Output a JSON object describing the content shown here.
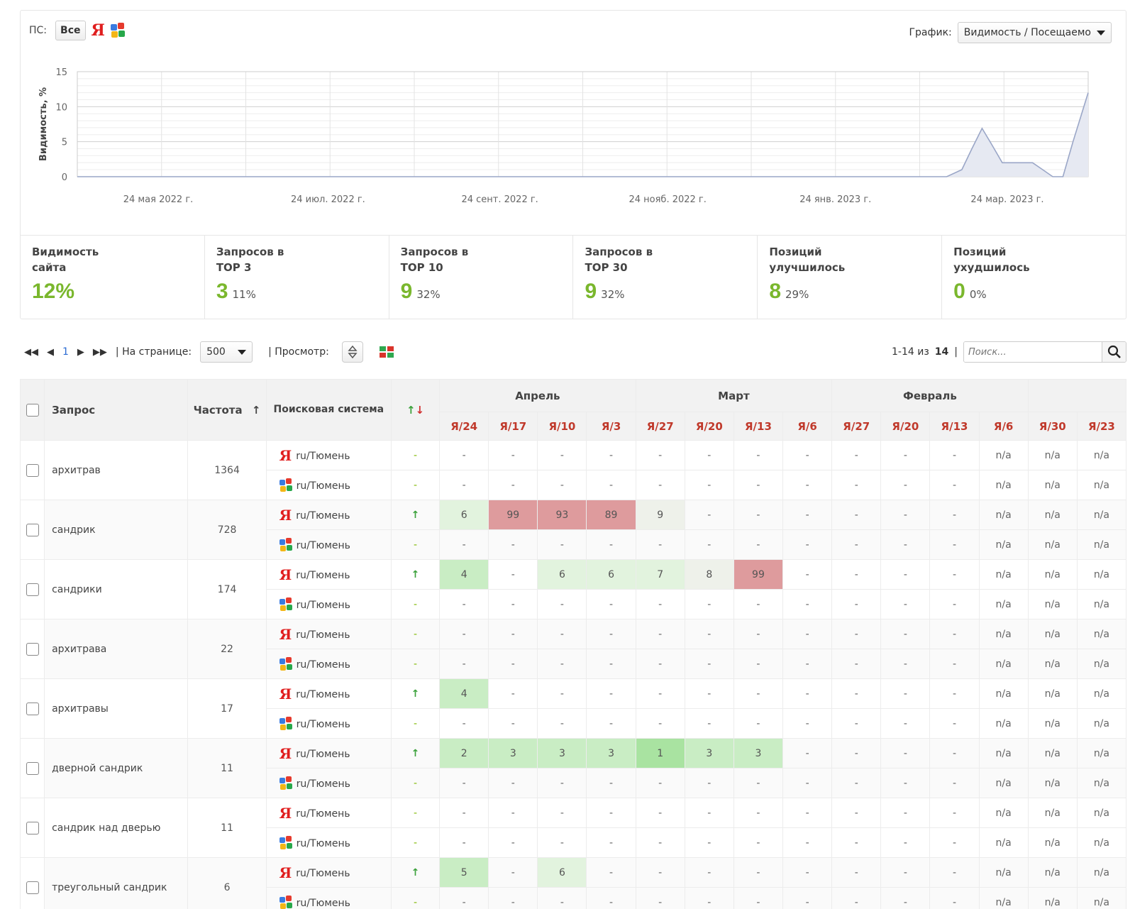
{
  "filter": {
    "ps_label": "ПС:",
    "all_label": "Все",
    "yandex_icon": "yandex-icon",
    "google_icon": "google-icon"
  },
  "graph": {
    "label": "График:",
    "selected": "Видимость / Посещаемо"
  },
  "chart_data": {
    "type": "area",
    "ylabel": "Видимость, %",
    "ylim": [
      0,
      15
    ],
    "yticks": [
      0,
      5,
      10,
      15
    ],
    "x_ticks": [
      "24 мая 2022 г.",
      "24 июл. 2022 г.",
      "24 сент. 2022 г.",
      "24 нояб. 2022 г.",
      "24 янв. 2023 г.",
      "24 мар. 2023 г."
    ],
    "grid": true,
    "series": [
      {
        "points": [
          [
            0,
            0
          ],
          [
            0.86,
            0
          ],
          [
            0.875,
            1
          ],
          [
            0.885,
            4
          ],
          [
            0.895,
            6.9
          ],
          [
            0.905,
            4.5
          ],
          [
            0.915,
            2
          ],
          [
            0.93,
            2
          ],
          [
            0.945,
            2
          ],
          [
            0.955,
            1
          ],
          [
            0.965,
            0
          ],
          [
            0.975,
            0
          ],
          [
            0.985,
            5
          ],
          [
            1.0,
            12
          ]
        ]
      }
    ],
    "color": "#9aa6c7"
  },
  "stats": [
    {
      "title": "Видимость\nсайта",
      "value": "12%",
      "pct": ""
    },
    {
      "title": "Запросов в\nTOP 3",
      "value": "3",
      "pct": "11%"
    },
    {
      "title": "Запросов в\nTOP 10",
      "value": "9",
      "pct": "32%"
    },
    {
      "title": "Запросов в\nTOP 30",
      "value": "9",
      "pct": "32%"
    },
    {
      "title": "Позиций\nулучшилось",
      "value": "8",
      "pct": "29%"
    },
    {
      "title": "Позиций\nухудшилось",
      "value": "0",
      "pct": "0%"
    }
  ],
  "toolbar": {
    "page": "1",
    "per_page_label": "| На странице:",
    "per_page_value": "500",
    "view_label": "| Просмотр:",
    "range": "1-14 из",
    "total": "14",
    "range_sep": "|",
    "search_placeholder": "Поиск..."
  },
  "table": {
    "headers": {
      "query": "Запрос",
      "freq": "Частота",
      "freq_sort": "↑",
      "se": "Поисковая система",
      "trend": "↑↓"
    },
    "months": [
      {
        "name": "Апрель",
        "span": 4
      },
      {
        "name": "Март",
        "span": 4
      },
      {
        "name": "Февраль",
        "span": 4
      },
      {
        "name": "",
        "span": 2
      }
    ],
    "dates": [
      "Я/24",
      "Я/17",
      "Я/10",
      "Я/3",
      "Я/27",
      "Я/20",
      "Я/13",
      "Я/6",
      "Я/27",
      "Я/20",
      "Я/13",
      "Я/6",
      "Я/30",
      "Я/23"
    ],
    "rows": [
      {
        "query": "архитрав",
        "freq": "1364",
        "ya": {
          "region": "ru/Тюмень",
          "trend": "-",
          "vals": [
            "-",
            "-",
            "-",
            "-",
            "-",
            "-",
            "-",
            "-",
            "-",
            "-",
            "-",
            "n/a",
            "n/a",
            "n/a"
          ]
        },
        "g": {
          "region": "ru/Тюмень",
          "trend": "-",
          "vals": [
            "-",
            "-",
            "-",
            "-",
            "-",
            "-",
            "-",
            "-",
            "-",
            "-",
            "-",
            "n/a",
            "n/a",
            "n/a"
          ]
        }
      },
      {
        "query": "сандрик",
        "freq": "728",
        "ya": {
          "region": "ru/Тюмень",
          "trend": "↑",
          "vals": [
            "6",
            "99",
            "93",
            "89",
            "9",
            "-",
            "-",
            "-",
            "-",
            "-",
            "-",
            "n/a",
            "n/a",
            "n/a"
          ],
          "cls": [
            "g3",
            "rd",
            "rd",
            "rd",
            "g4",
            "",
            "",
            "",
            "",
            "",
            "",
            "",
            "",
            ""
          ]
        },
        "g": {
          "region": "ru/Тюмень",
          "trend": "-",
          "vals": [
            "-",
            "-",
            "-",
            "-",
            "-",
            "-",
            "-",
            "-",
            "-",
            "-",
            "-",
            "n/a",
            "n/a",
            "n/a"
          ]
        }
      },
      {
        "query": "сандрики",
        "freq": "174",
        "ya": {
          "region": "ru/Тюмень",
          "trend": "↑",
          "vals": [
            "4",
            "-",
            "6",
            "6",
            "7",
            "8",
            "99",
            "-",
            "-",
            "-",
            "-",
            "n/a",
            "n/a",
            "n/a"
          ],
          "cls": [
            "g2",
            "",
            "g3",
            "g3",
            "g3",
            "g4",
            "rd",
            "",
            "",
            "",
            "",
            "",
            "",
            ""
          ]
        },
        "g": {
          "region": "ru/Тюмень",
          "trend": "-",
          "vals": [
            "-",
            "-",
            "-",
            "-",
            "-",
            "-",
            "-",
            "-",
            "-",
            "-",
            "-",
            "n/a",
            "n/a",
            "n/a"
          ]
        }
      },
      {
        "query": "архитрава",
        "freq": "22",
        "ya": {
          "region": "ru/Тюмень",
          "trend": "-",
          "vals": [
            "-",
            "-",
            "-",
            "-",
            "-",
            "-",
            "-",
            "-",
            "-",
            "-",
            "-",
            "n/a",
            "n/a",
            "n/a"
          ]
        },
        "g": {
          "region": "ru/Тюмень",
          "trend": "-",
          "vals": [
            "-",
            "-",
            "-",
            "-",
            "-",
            "-",
            "-",
            "-",
            "-",
            "-",
            "-",
            "n/a",
            "n/a",
            "n/a"
          ]
        }
      },
      {
        "query": "архитравы",
        "freq": "17",
        "ya": {
          "region": "ru/Тюмень",
          "trend": "↑",
          "vals": [
            "4",
            "-",
            "-",
            "-",
            "-",
            "-",
            "-",
            "-",
            "-",
            "-",
            "-",
            "n/a",
            "n/a",
            "n/a"
          ],
          "cls": [
            "g2",
            "",
            "",
            "",
            "",
            "",
            "",
            "",
            "",
            "",
            "",
            "",
            "",
            ""
          ]
        },
        "g": {
          "region": "ru/Тюмень",
          "trend": "-",
          "vals": [
            "-",
            "-",
            "-",
            "-",
            "-",
            "-",
            "-",
            "-",
            "-",
            "-",
            "-",
            "n/a",
            "n/a",
            "n/a"
          ]
        }
      },
      {
        "query": "дверной сандрик",
        "freq": "11",
        "ya": {
          "region": "ru/Тюмень",
          "trend": "↑",
          "vals": [
            "2",
            "3",
            "3",
            "3",
            "1",
            "3",
            "3",
            "-",
            "-",
            "-",
            "-",
            "n/a",
            "n/a",
            "n/a"
          ],
          "cls": [
            "g2",
            "g2",
            "g2",
            "g2",
            "g1",
            "g2",
            "g2",
            "",
            "",
            "",
            "",
            "",
            "",
            ""
          ]
        },
        "g": {
          "region": "ru/Тюмень",
          "trend": "-",
          "vals": [
            "-",
            "-",
            "-",
            "-",
            "-",
            "-",
            "-",
            "-",
            "-",
            "-",
            "-",
            "n/a",
            "n/a",
            "n/a"
          ]
        }
      },
      {
        "query": "сандрик над дверью",
        "freq": "11",
        "ya": {
          "region": "ru/Тюмень",
          "trend": "-",
          "vals": [
            "-",
            "-",
            "-",
            "-",
            "-",
            "-",
            "-",
            "-",
            "-",
            "-",
            "-",
            "n/a",
            "n/a",
            "n/a"
          ]
        },
        "g": {
          "region": "ru/Тюмень",
          "trend": "-",
          "vals": [
            "-",
            "-",
            "-",
            "-",
            "-",
            "-",
            "-",
            "-",
            "-",
            "-",
            "-",
            "n/a",
            "n/a",
            "n/a"
          ]
        }
      },
      {
        "query": "треугольный сандрик",
        "freq": "6",
        "ya": {
          "region": "ru/Тюмень",
          "trend": "↑",
          "vals": [
            "5",
            "-",
            "6",
            "-",
            "-",
            "-",
            "-",
            "-",
            "-",
            "-",
            "-",
            "n/a",
            "n/a",
            "n/a"
          ],
          "cls": [
            "g2",
            "",
            "g3",
            "",
            "",
            "",
            "",
            "",
            "",
            "",
            "",
            "",
            "",
            ""
          ]
        },
        "g": {
          "region": "ru/Тюмень",
          "trend": "-",
          "vals": [
            "-",
            "-",
            "-",
            "-",
            "-",
            "-",
            "-",
            "-",
            "-",
            "-",
            "-",
            "n/a",
            "n/a",
            "n/a"
          ]
        }
      }
    ]
  }
}
